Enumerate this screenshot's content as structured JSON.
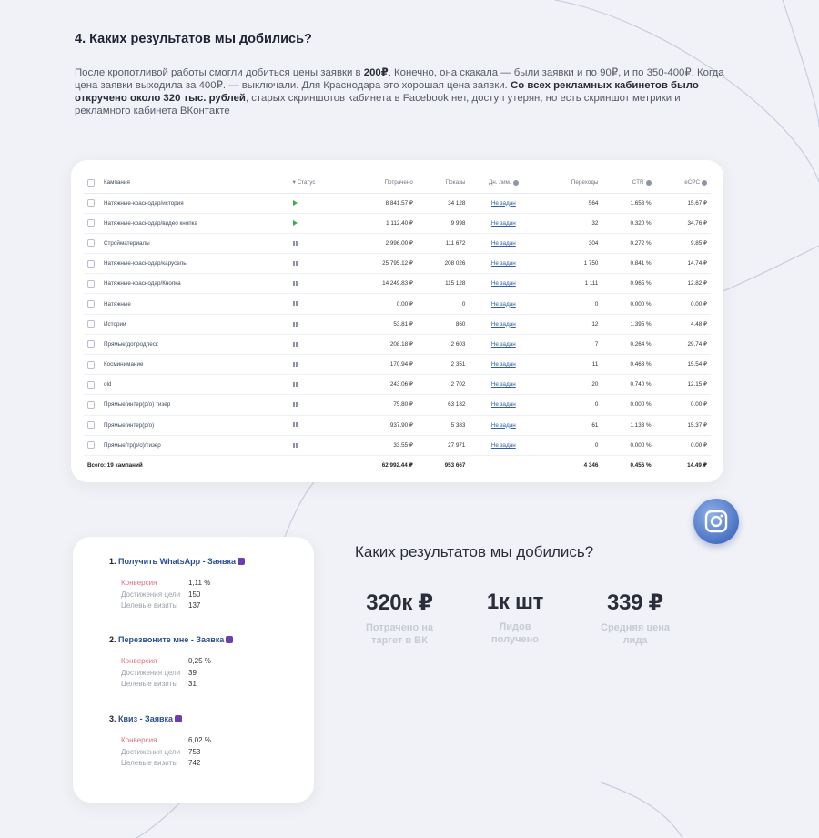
{
  "heading": "4.  Каких результатов мы добились?",
  "intro": {
    "p1": "После кропотливой работы смогли добиться цены заявки в ",
    "price": "200₽",
    "p2": ". Конечно, она скакала — были заявки и по 90₽, и по 350-400₽. Когда цена заявки выходила за 400₽. — выключали. Для Краснодара это хорошая цена заявки. ",
    "bold": "Со всех рекламных кабинетов было откручено около 320 тыс. рублей",
    "p3": ", старых скриншотов кабинета в Facebook нет, доступ утерян, но есть скриншот метрики и рекламного кабинета ВКонтакте"
  },
  "table": {
    "headers": {
      "campaign": "Кампания",
      "status": "▾ Статус",
      "spent": "Потрачено",
      "shows": "Показы",
      "limit": "Дн. лим.",
      "clicks": "Переходы",
      "ctr": "CTR",
      "ecpc": "eCPC"
    },
    "rows": [
      {
        "name": "Натяжные-краснодар/история",
        "status": "play",
        "spent": "8 841.57 ₽",
        "shows": "34 128",
        "limit": "Не задан",
        "clicks": "564",
        "ctr": "1.653 %",
        "ecpc": "15.67 ₽"
      },
      {
        "name": "Натяжные-краснодар/видео кнопка",
        "status": "play",
        "spent": "1 112.40 ₽",
        "shows": "9 998",
        "limit": "Не задан",
        "clicks": "32",
        "ctr": "0.320 %",
        "ecpc": "34.76 ₽"
      },
      {
        "name": "Стройматериалы",
        "status": "pause",
        "spent": "2 996.00 ₽",
        "shows": "111 672",
        "limit": "Не задан",
        "clicks": "304",
        "ctr": "0.272 %",
        "ecpc": "9.85 ₽"
      },
      {
        "name": "Натяжные-краснодар/карусель",
        "status": "pause",
        "spent": "25 795.12 ₽",
        "shows": "208 026",
        "limit": "Не задан",
        "clicks": "1 750",
        "ctr": "0.841 %",
        "ecpc": "14.74 ₽"
      },
      {
        "name": "Натяжные-краснодар/Кнопка",
        "status": "pause",
        "spent": "14 249.83 ₽",
        "shows": "115 128",
        "limit": "Не задан",
        "clicks": "1 111",
        "ctr": "0.965 %",
        "ecpc": "12.82 ₽"
      },
      {
        "name": "Натяжные",
        "status": "pause",
        "spent": "0.00 ₽",
        "shows": "0",
        "limit": "Не задан",
        "clicks": "0",
        "ctr": "0.000 %",
        "ecpc": "0.00 ₽"
      },
      {
        "name": "Истории",
        "status": "pause",
        "spent": "53.81 ₽",
        "shows": "860",
        "limit": "Не задан",
        "clicks": "12",
        "ctr": "1.395 %",
        "ecpc": "4.48 ₽"
      },
      {
        "name": "Прямые/допродлеск",
        "status": "pause",
        "spent": "208.18 ₽",
        "shows": "2 603",
        "limit": "Не задан",
        "clicks": "7",
        "ctr": "0.264 %",
        "ecpc": "29.74 ₽"
      },
      {
        "name": "Косминимание",
        "status": "pause",
        "spent": "170.94 ₽",
        "shows": "2 351",
        "limit": "Не задан",
        "clicks": "11",
        "ctr": "0.468 %",
        "ecpc": "15.54 ₽"
      },
      {
        "name": "old",
        "status": "pause",
        "spent": "243.06 ₽",
        "shows": "2 702",
        "limit": "Не задан",
        "clicks": "20",
        "ctr": "0.740 %",
        "ecpc": "12.15 ₽"
      },
      {
        "name": "Прямые/интер(р/о) тизер",
        "status": "pause",
        "spent": "75.80 ₽",
        "shows": "63 182",
        "limit": "Не задан",
        "clicks": "0",
        "ctr": "0.000 %",
        "ecpc": "0.00 ₽"
      },
      {
        "name": "Прямые/интер(р/о)",
        "status": "pause",
        "spent": "937.90 ₽",
        "shows": "5 383",
        "limit": "Не задан",
        "clicks": "61",
        "ctr": "1.133 %",
        "ecpc": "15.37 ₽"
      },
      {
        "name": "Прямые/тр(р/о)/тизер",
        "status": "pause",
        "spent": "33.55 ₽",
        "shows": "27 971",
        "limit": "Не задан",
        "clicks": "0",
        "ctr": "0.000 %",
        "ecpc": "0.00 ₽"
      }
    ],
    "total": {
      "name": "Всего: 19 кампаний",
      "spent": "62 992.44 ₽",
      "shows": "953 667",
      "clicks": "4 346",
      "ctr": "0.456 %",
      "ecpc": "14.49 ₽"
    }
  },
  "goals": [
    {
      "num": "1.",
      "name": "Получить WhatsApp - Заявка",
      "rows": [
        {
          "label": "Конверсия",
          "value": "1,11 %"
        },
        {
          "label": "Достижения цели",
          "value": "150"
        },
        {
          "label": "Целевые визиты",
          "value": "137"
        }
      ]
    },
    {
      "num": "2.",
      "name": "Перезвоните мне - Заявка",
      "rows": [
        {
          "label": "Конверсия",
          "value": "0,25 %"
        },
        {
          "label": "Достижения цели",
          "value": "39"
        },
        {
          "label": "Целевые визиты",
          "value": "31"
        }
      ]
    },
    {
      "num": "3.",
      "name": "Квиз - Заявка",
      "rows": [
        {
          "label": "Конверсия",
          "value": "6,02 %"
        },
        {
          "label": "Достижения цели",
          "value": "753"
        },
        {
          "label": "Целевые визиты",
          "value": "742"
        }
      ]
    }
  ],
  "results": {
    "title": "Каких результатов мы добились?",
    "metrics": [
      {
        "value": "320к ₽",
        "label": "Потрачено на таргет в ВК"
      },
      {
        "value": "1к шт",
        "label": "Лидов получено"
      },
      {
        "value": "339 ₽",
        "label": "Средняя цена лида"
      }
    ]
  },
  "colors": {
    "background": "#f1f2f7",
    "accent": "#4a73c4",
    "link": "#2d5fa8",
    "conversion": "#d9737f"
  },
  "icons": {
    "social": "instagram-icon"
  }
}
